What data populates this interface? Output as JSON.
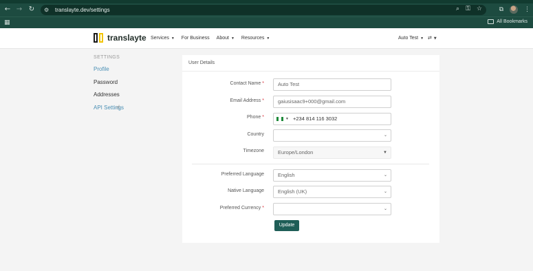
{
  "browser": {
    "url": "translayte.dev/settings",
    "bookmarks_label": "All Bookmarks",
    "icons": [
      "back-icon",
      "forward-icon",
      "reload-icon",
      "site-settings-icon",
      "zoom-icon",
      "password-icon",
      "star-icon",
      "extensions-icon",
      "profile-avatar",
      "menu-icon",
      "apps-icon",
      "folder-icon"
    ]
  },
  "header": {
    "logo_text": "translayte",
    "nav": [
      {
        "label": "Services",
        "has_caret": true
      },
      {
        "label": "For Business",
        "has_caret": false
      },
      {
        "label": "About",
        "has_caret": true
      },
      {
        "label": "Resources",
        "has_caret": true
      }
    ],
    "account_label": "Auto Test"
  },
  "sidebar": {
    "heading": "SETTINGS",
    "items": [
      {
        "label": "Profile",
        "active": true
      },
      {
        "label": "Password",
        "active": false
      },
      {
        "label": "Addresses",
        "active": false
      },
      {
        "label": "API Settings",
        "active": true
      }
    ]
  },
  "form": {
    "title": "User Details",
    "contact_name": {
      "label": "Contact Name",
      "required": true,
      "value": "Auto Test"
    },
    "email": {
      "label": "Email Address",
      "required": true,
      "value": "gaiusisaac9+000@gmail.com"
    },
    "phone": {
      "label": "Phone",
      "required": true,
      "value": "+234 814 116 3032",
      "flag_colors": [
        "#1f8a3a",
        "#ffffff",
        "#1f8a3a"
      ]
    },
    "country": {
      "label": "Country",
      "required": false,
      "value": ""
    },
    "timezone": {
      "label": "Timezone",
      "required": false,
      "value": "Europe/London"
    },
    "preferred_language": {
      "label": "Preferred Language",
      "required": false,
      "value": "English"
    },
    "native_language": {
      "label": "Native Language",
      "required": false,
      "value": "English (UK)"
    },
    "preferred_currency": {
      "label": "Preferred Currency",
      "required": true,
      "value": ""
    },
    "submit_label": "Update"
  },
  "colors": {
    "brand_dark": "#1f5e57",
    "link": "#4a8fb4",
    "required": "#d9303a"
  }
}
